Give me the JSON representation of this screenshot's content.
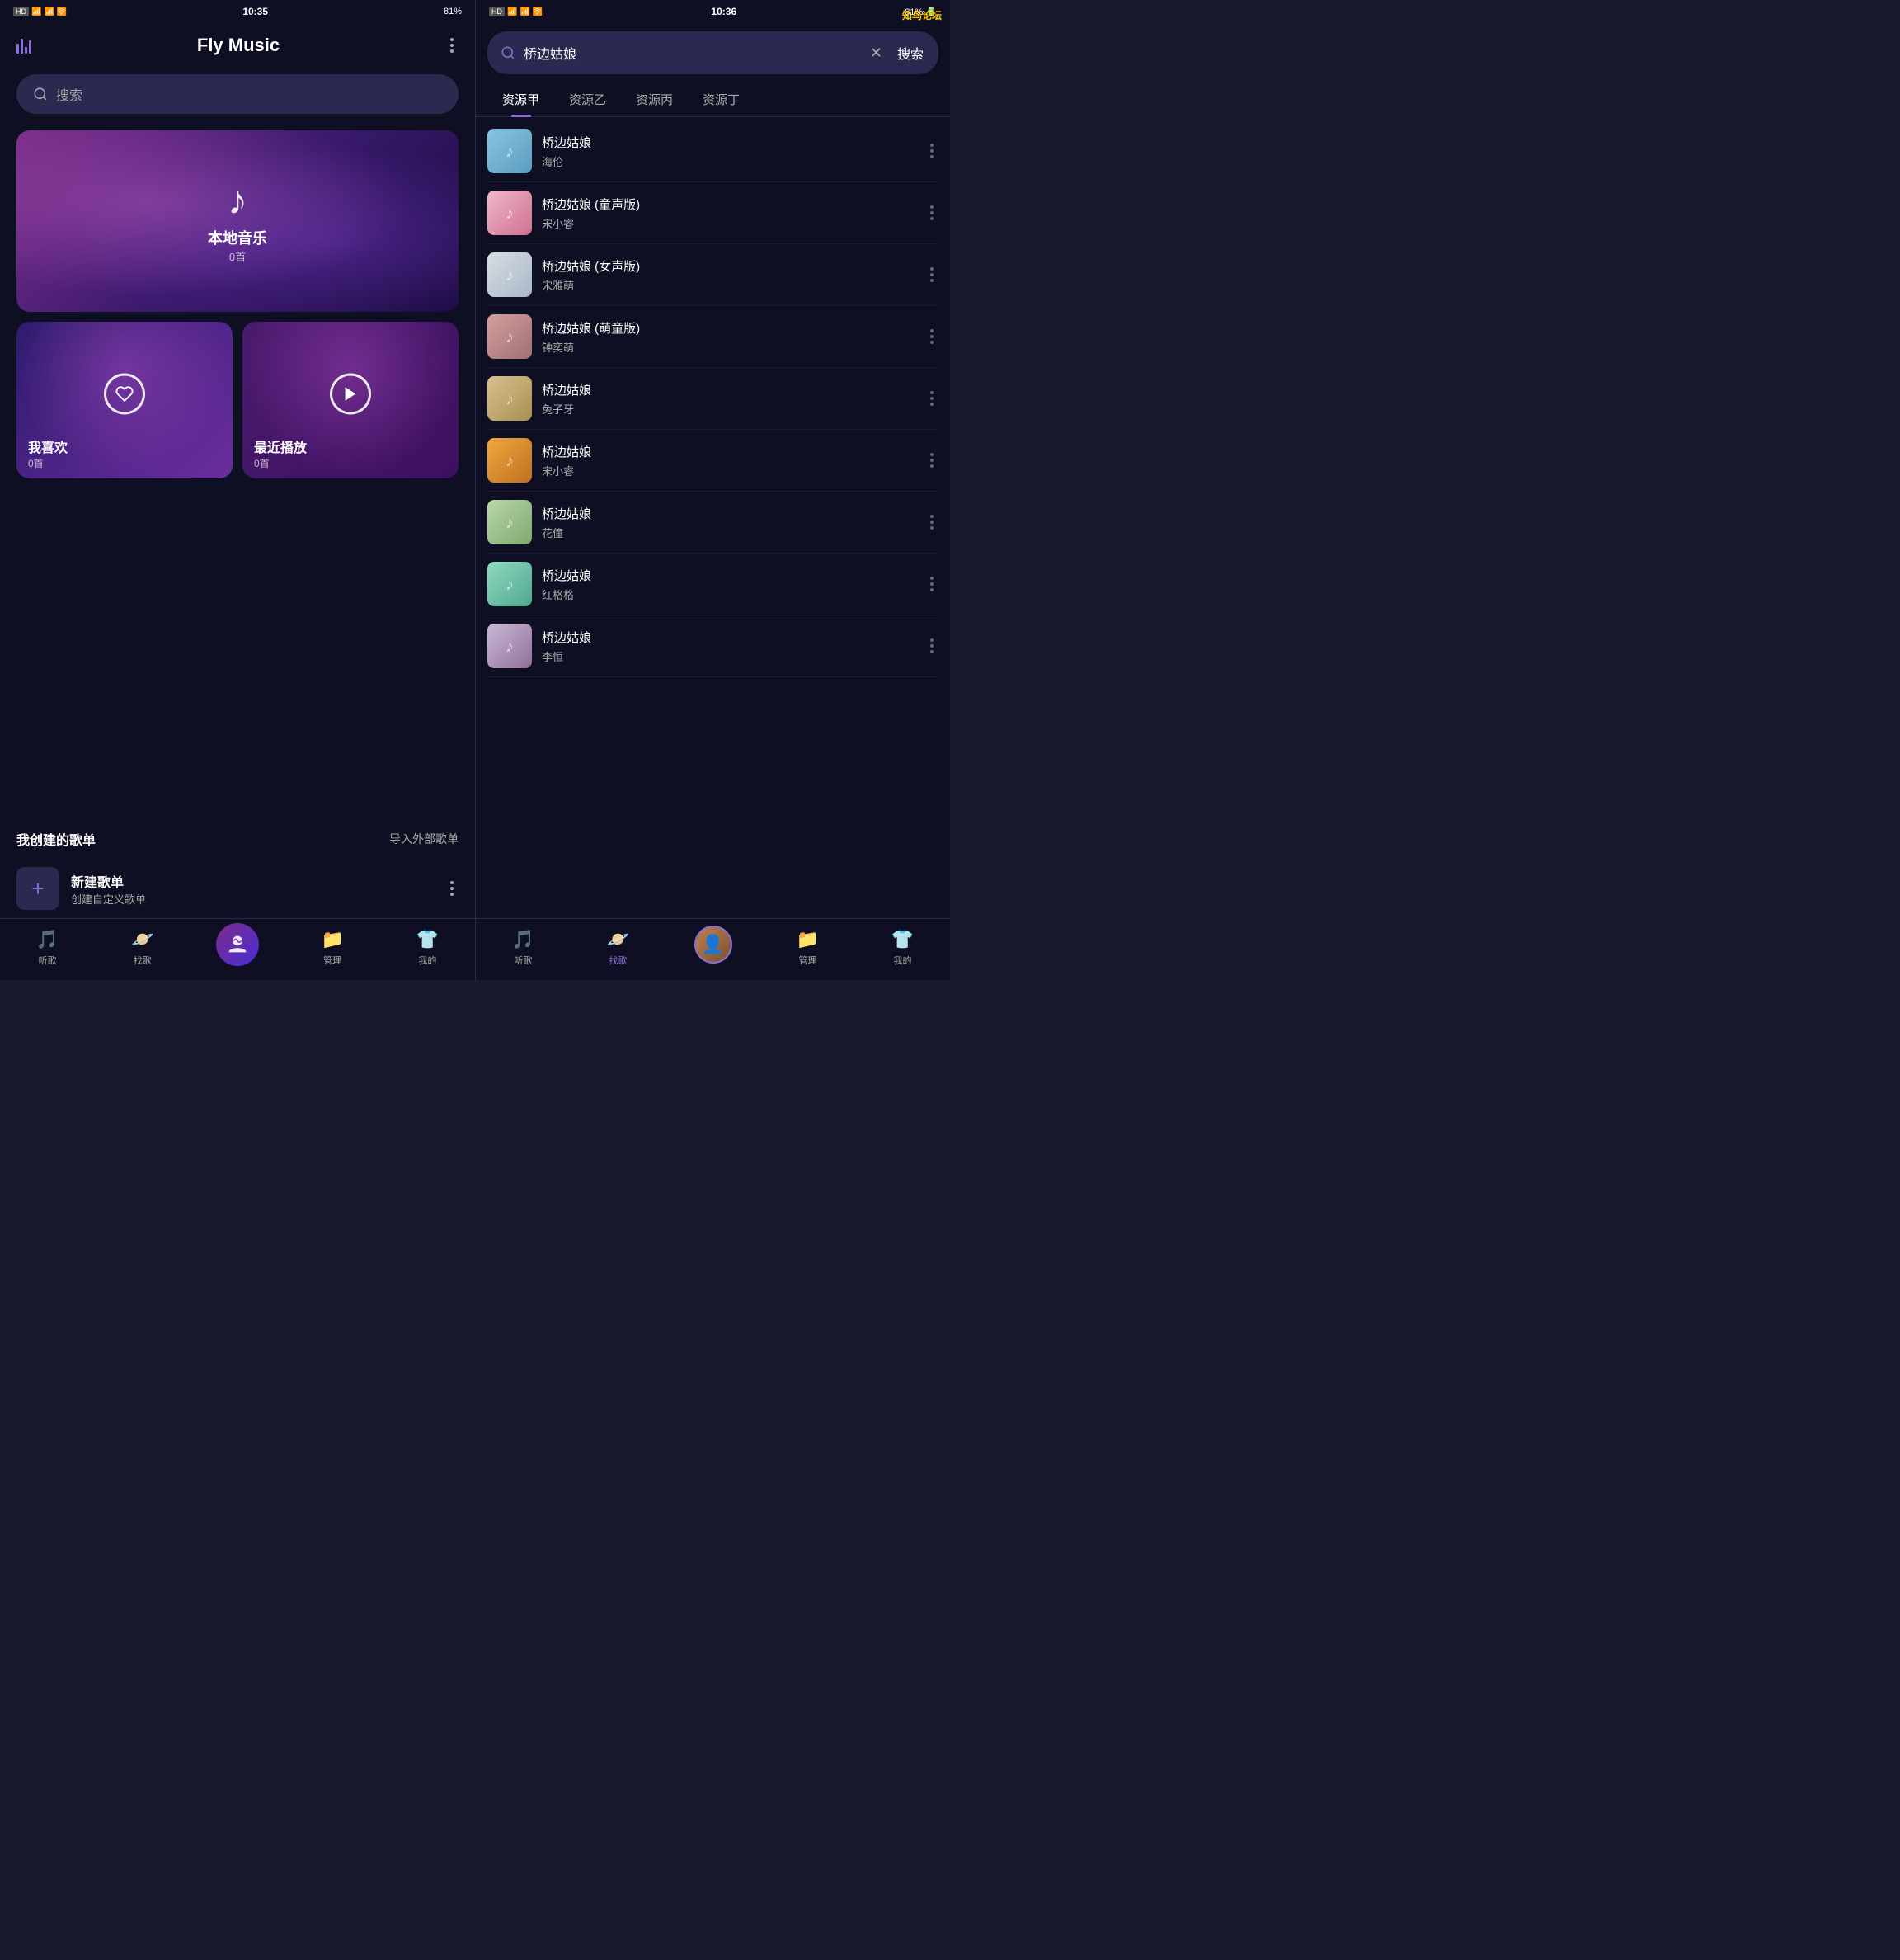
{
  "left": {
    "statusBar": {
      "signal": "HD 46 46",
      "battery": "81%",
      "time": "10:35"
    },
    "header": {
      "title": "Fly Music",
      "menuDots": "···"
    },
    "searchPlaceholder": "搜索",
    "mainCard": {
      "title": "本地音乐",
      "count": "0首"
    },
    "subCards": [
      {
        "title": "我喜欢",
        "count": "0首",
        "type": "likes"
      },
      {
        "title": "最近播放",
        "count": "0首",
        "type": "recent"
      }
    ],
    "playlistSection": {
      "title": "我创建的歌单",
      "importLabel": "导入外部歌单"
    },
    "newPlaylist": {
      "title": "新建歌单",
      "subtitle": "创建自定义歌单"
    },
    "bottomNav": [
      {
        "label": "听歌",
        "icon": "music-note",
        "active": false
      },
      {
        "label": "找歌",
        "icon": "discover",
        "active": false
      },
      {
        "label": "",
        "icon": "center",
        "active": false
      },
      {
        "label": "管理",
        "icon": "folder",
        "active": false
      },
      {
        "label": "我的",
        "icon": "shirt",
        "active": false
      }
    ]
  },
  "right": {
    "statusBar": {
      "signal": "HD 46 46",
      "battery": "81%",
      "time": "10:36"
    },
    "searchQuery": "桥边姑娘",
    "clearBtn": "✕",
    "submitBtn": "搜索",
    "tabs": [
      {
        "label": "资源甲",
        "active": true
      },
      {
        "label": "资源乙",
        "active": false
      },
      {
        "label": "资源丙",
        "active": false
      },
      {
        "label": "资源丁",
        "active": false
      }
    ],
    "results": [
      {
        "title": "桥边姑娘",
        "artist": "海伦",
        "thumbClass": "thumb-1"
      },
      {
        "title": "桥边姑娘 (童声版)",
        "artist": "宋小睿",
        "thumbClass": "thumb-2"
      },
      {
        "title": "桥边姑娘 (女声版)",
        "artist": "宋雅萌",
        "thumbClass": "thumb-3"
      },
      {
        "title": "桥边姑娘 (萌童版)",
        "artist": "钟奕萌",
        "thumbClass": "thumb-4"
      },
      {
        "title": "桥边姑娘",
        "artist": "兔子牙",
        "thumbClass": "thumb-5"
      },
      {
        "title": "桥边姑娘",
        "artist": "宋小睿",
        "thumbClass": "thumb-6"
      },
      {
        "title": "桥边姑娘",
        "artist": "花僮",
        "thumbClass": "thumb-7"
      },
      {
        "title": "桥边姑娘",
        "artist": "红格格",
        "thumbClass": "thumb-8"
      },
      {
        "title": "桥边姑娘",
        "artist": "李恒",
        "thumbClass": "thumb-9"
      }
    ],
    "bottomNav": [
      {
        "label": "听歌",
        "icon": "music-note",
        "active": false
      },
      {
        "label": "找歌",
        "icon": "discover",
        "active": true
      },
      {
        "label": "",
        "icon": "avatar",
        "active": false
      },
      {
        "label": "管理",
        "icon": "folder",
        "active": false
      },
      {
        "label": "我的",
        "icon": "shirt",
        "active": false
      }
    ],
    "watermark": "知鸟论坛"
  }
}
